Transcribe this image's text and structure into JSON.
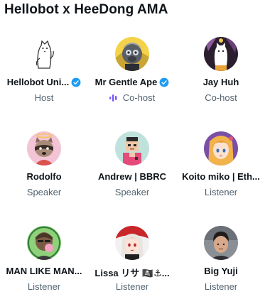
{
  "space": {
    "title": "Hellobot x HeeDong AMA"
  },
  "colors": {
    "verified": "#1d9bf0",
    "speaking": "#7856ff",
    "secondary_text": "#536471"
  },
  "participants": [
    {
      "name": "Hellobot Uni...",
      "role": "Host",
      "verified": true,
      "avatar_icon": "white-cat-avatar-icon"
    },
    {
      "name": "Mr Gentle Ape",
      "role": "Co-host",
      "verified": true,
      "speaking": true,
      "avatar_icon": "ape-avatar-icon"
    },
    {
      "name": "Jay Huh",
      "role": "Co-host",
      "verified": false,
      "avatar_icon": "cat-avatar-icon"
    },
    {
      "name": "Rodolfo",
      "role": "Speaker",
      "verified": false,
      "avatar_icon": "raccoon-avatar-icon"
    },
    {
      "name": "Andrew | BBRC",
      "role": "Speaker",
      "verified": false,
      "avatar_icon": "pixel-character-avatar-icon"
    },
    {
      "name": "Koito miko | Eth...",
      "role": "Listener",
      "verified": false,
      "avatar_icon": "anime-girl-avatar-icon"
    },
    {
      "name": "MAN LIKE MAN...",
      "role": "Listener",
      "verified": false,
      "avatar_icon": "bubblegum-avatar-icon"
    },
    {
      "name": "Lissa リサ 🏴‍☠️⚓...",
      "role": "Listener",
      "verified": false,
      "avatar_icon": "anime-character-avatar-icon"
    },
    {
      "name": "Big Yuji",
      "role": "Listener",
      "verified": false,
      "avatar_icon": "person-photo-avatar-icon"
    }
  ]
}
